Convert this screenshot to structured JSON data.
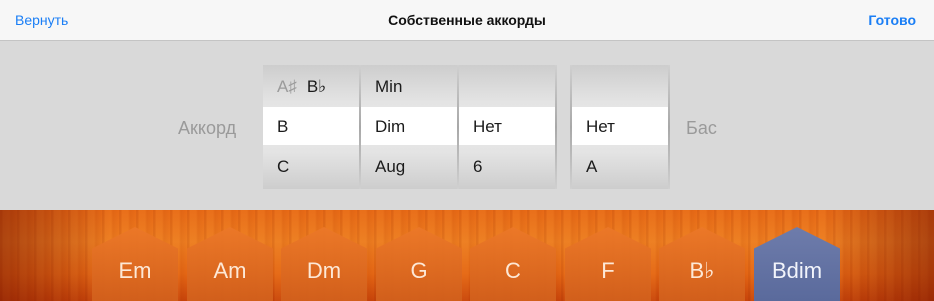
{
  "nav": {
    "back_label": "Вернуть",
    "title": "Собственные аккорды",
    "done_label": "Готово"
  },
  "picker": {
    "chord_label": "Аккорд",
    "bass_label": "Бас",
    "root_column": {
      "above_a": "A♯",
      "above_b": "B♭",
      "selected": "B",
      "below": "C"
    },
    "quality_column": {
      "above": "Min",
      "selected": "Dim",
      "below": "Aug"
    },
    "extension_column": {
      "above": "",
      "selected": "Нет",
      "below": "6"
    },
    "bass_column": {
      "above": "",
      "selected": "Нет",
      "below": "A"
    }
  },
  "chord_strip": {
    "chords": [
      {
        "label": "Em"
      },
      {
        "label": "Am"
      },
      {
        "label": "Dm"
      },
      {
        "label": "G"
      },
      {
        "label": "C"
      },
      {
        "label": "F"
      },
      {
        "label": "B♭"
      },
      {
        "label": "Bdim"
      }
    ],
    "selected_index": 7
  },
  "colors": {
    "accent": "#1a7ef5",
    "wood": "#e86a16",
    "selected_chord": "#6e7cab"
  }
}
